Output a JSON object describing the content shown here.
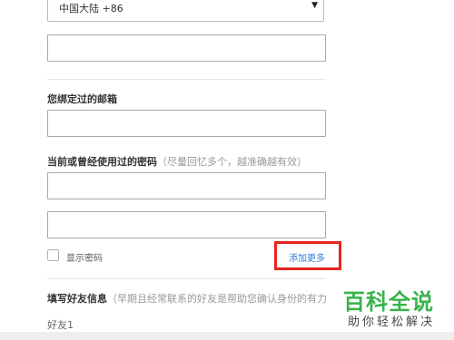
{
  "phone": {
    "country_selected": "中国大陆 +86",
    "number_value": ""
  },
  "email": {
    "label": "您绑定过的邮箱",
    "value": ""
  },
  "password": {
    "label": "当前或曾经使用过的密码",
    "hint": "（尽量回忆多个，越准确越有效）",
    "value1": "",
    "value2": "",
    "show_password_label": "显示密码",
    "show_password_checked": false,
    "add_more_label": "添加更多"
  },
  "friends": {
    "label": "填写好友信息",
    "hint": "（早期且经常联系的好友是帮助您确认身份的有力",
    "friend1_label": "好友1"
  },
  "watermark": {
    "title": "百科全说",
    "subtitle": "助你轻松解决"
  },
  "colors": {
    "highlight_box": "#e32620",
    "link": "#2f7ed8",
    "watermark_green": "#38b34a"
  }
}
